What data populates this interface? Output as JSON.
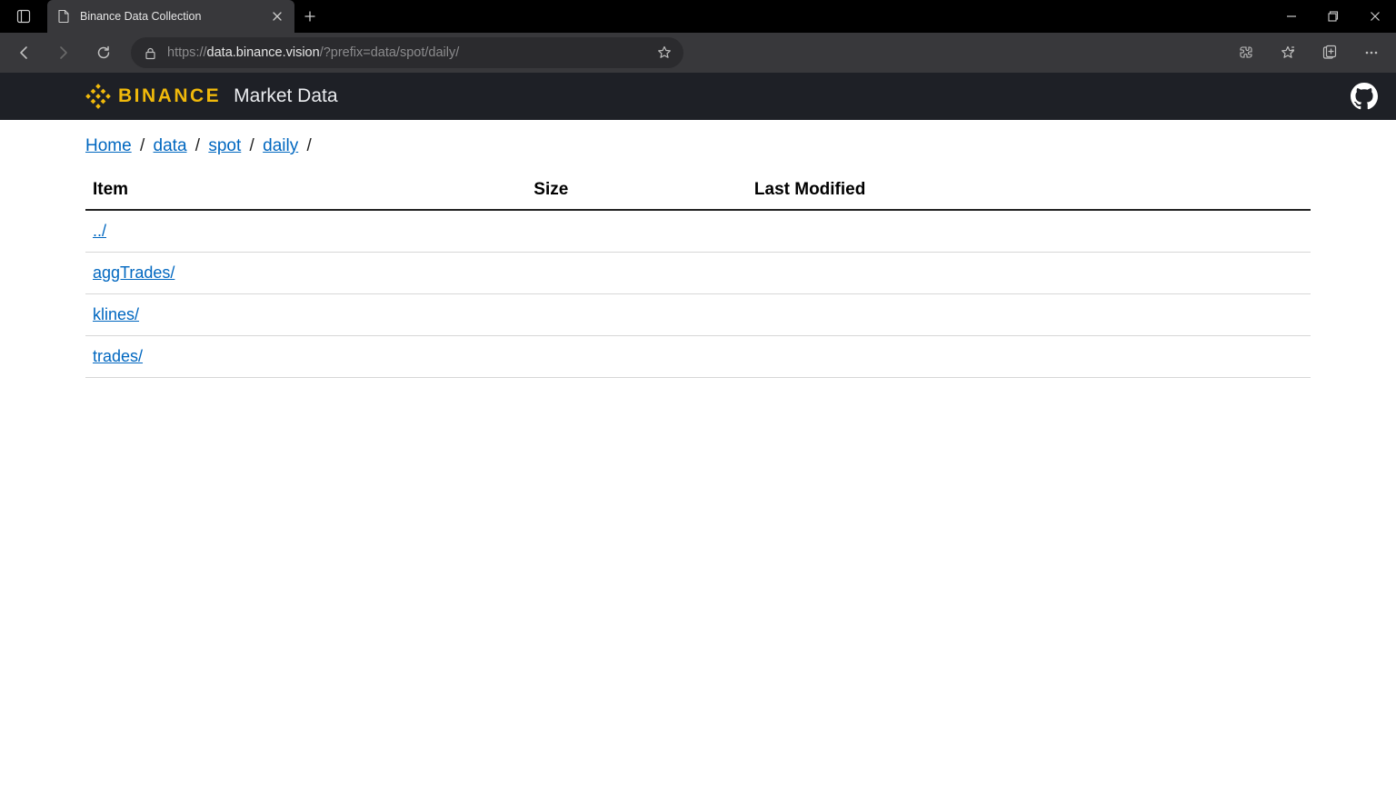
{
  "browser": {
    "tab_title": "Binance Data Collection",
    "url_scheme": "https",
    "url_host": "data.binance.vision",
    "url_path": "/?prefix=data/spot/daily/"
  },
  "header": {
    "logo_text": "BINANCE",
    "site_title": "Market Data"
  },
  "breadcrumb": {
    "items": [
      "Home",
      "data",
      "spot",
      "daily"
    ]
  },
  "table": {
    "headers": {
      "item": "Item",
      "size": "Size",
      "modified": "Last Modified"
    },
    "rows": [
      {
        "name": "../",
        "size": "",
        "modified": ""
      },
      {
        "name": "aggTrades/",
        "size": "",
        "modified": ""
      },
      {
        "name": "klines/",
        "size": "",
        "modified": ""
      },
      {
        "name": "trades/",
        "size": "",
        "modified": ""
      }
    ]
  }
}
